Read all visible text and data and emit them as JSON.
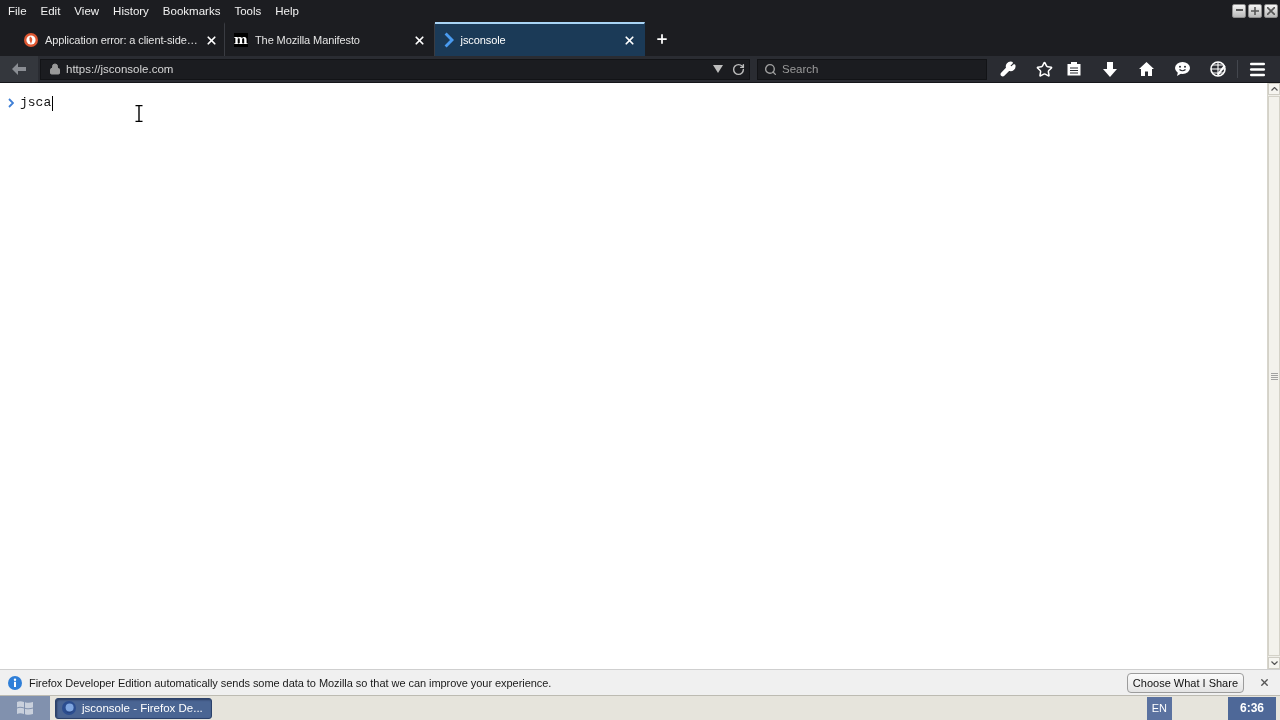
{
  "menu_bar": {
    "items": [
      "File",
      "Edit",
      "View",
      "History",
      "Bookmarks",
      "Tools",
      "Help"
    ]
  },
  "tabs": [
    {
      "title": "Application error: a client-side…",
      "kind": "circle-logo",
      "selected": false
    },
    {
      "title": "The Mozilla Manifesto",
      "kind": "letter-logo",
      "logo": "m",
      "selected": false
    },
    {
      "title": "jsconsole",
      "kind": "prompt",
      "selected": true
    }
  ],
  "nav_bar": {
    "url": "https://jsconsole.com",
    "search": {
      "placeholder": "Search"
    }
  },
  "console": {
    "input": "jsca"
  },
  "notification": {
    "message": "Firefox Developer Edition automatically sends some data to Mozilla so that we can improve your experience.",
    "button": "Choose What I Share"
  },
  "taskbar": {
    "tasks": [
      {
        "title": "jsconsole - Firefox De...",
        "active": true
      }
    ],
    "language": "EN",
    "clock": "6:36"
  }
}
